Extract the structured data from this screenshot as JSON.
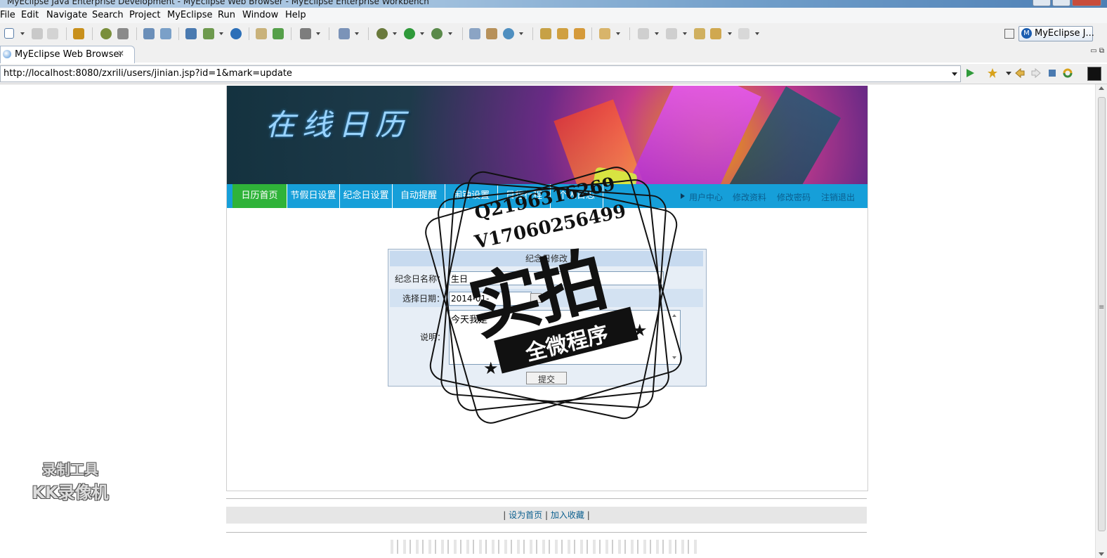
{
  "window": {
    "title": "MyEclipse Java Enterprise Development - MyEclipse Web Browser - MyEclipse Enterprise Workbench"
  },
  "menu": [
    "File",
    "Edit",
    "Navigate",
    "Search",
    "Project",
    "MyEclipse",
    "Run",
    "Window",
    "Help"
  ],
  "perspective": {
    "label": "MyEclipse J..."
  },
  "tab": {
    "label": "MyEclipse Web Browser",
    "close": "✕"
  },
  "url": {
    "value": "http://localhost:8080/zxrili/users/jinian.jsp?id=1&mark=update"
  },
  "site": {
    "banner_title": "在线日历",
    "nav": [
      "日历首页",
      "节假日设置",
      "纪念日设置",
      "自动提醒",
      "闹钟设置",
      "日程行程",
      "个人日志"
    ],
    "nav_active": "日历首页",
    "right_links": [
      "用户中心",
      "修改资料",
      "修改密码",
      "注销退出"
    ],
    "form": {
      "title": "纪念日修改",
      "name_label": "纪念日名称：",
      "name_value": "生日",
      "date_label": "选择日期：",
      "date_value": "2014-01-",
      "desc_label": "说明：",
      "desc_value": "今天我是",
      "submit_label": "提交"
    },
    "footer": {
      "sep": "|",
      "link1": "设为首页",
      "link2": "加入收藏"
    }
  },
  "overlay": {
    "stamp_line1": "Q2196316269",
    "stamp_line2": "V17060256499",
    "stamp_big": "实拍",
    "stamp_ribbon": "全微程序",
    "watermark_line1": "录制工具",
    "watermark_line2": "KK录像机"
  }
}
